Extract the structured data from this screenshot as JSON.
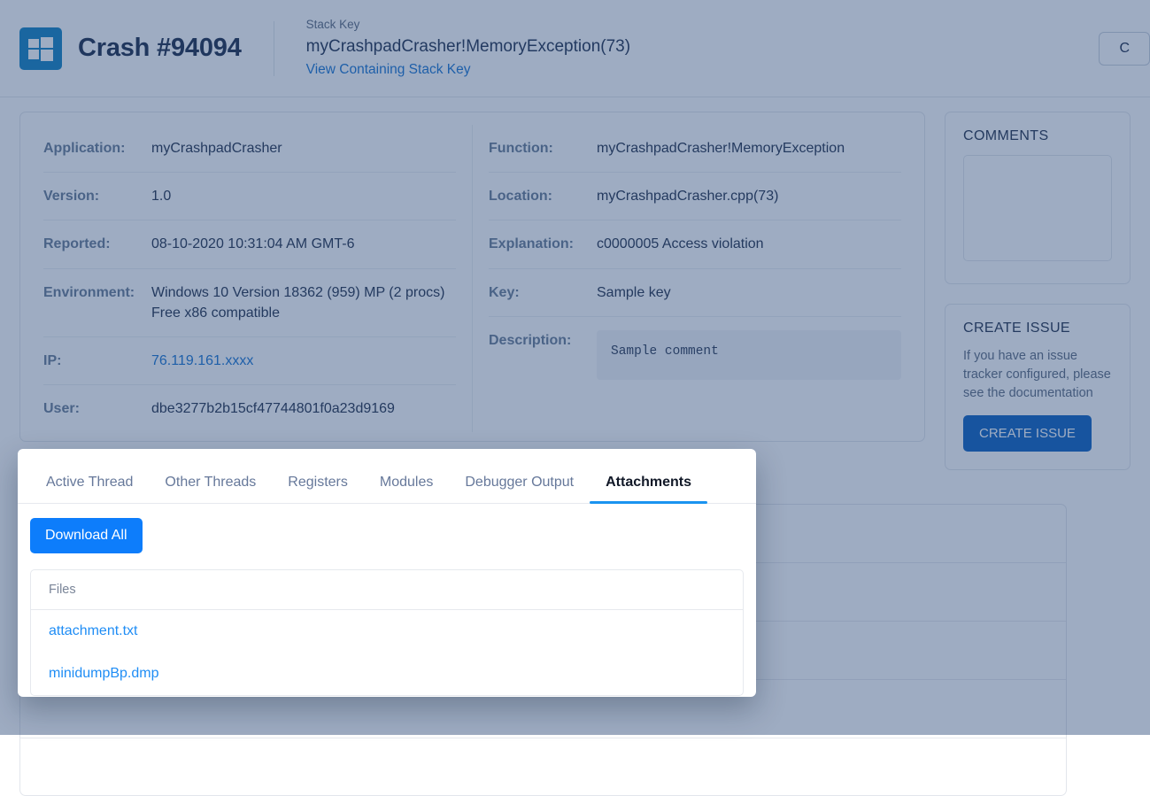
{
  "header": {
    "logo_icon": "windows-logo-icon",
    "crash_title": "Crash #94094",
    "stack_key_label": "Stack Key",
    "stack_key_value": "myCrashpadCrasher!MemoryException(73)",
    "stack_key_link": "View Containing Stack Key",
    "right_button": "C"
  },
  "details": {
    "left": [
      {
        "key": "Application:",
        "value": "myCrashpadCrasher",
        "link": false
      },
      {
        "key": "Version:",
        "value": "1.0",
        "link": false
      },
      {
        "key": "Reported:",
        "value": "08-10-2020 10:31:04 AM GMT-6",
        "link": false
      },
      {
        "key": "Environment:",
        "value": "Windows 10 Version 18362 (959) MP (2 procs) Free x86 compatible",
        "link": false
      },
      {
        "key": "IP:",
        "value": "76.119.161.xxxx",
        "link": true
      },
      {
        "key": "User:",
        "value": "dbe3277b2b15cf47744801f0a23d9169",
        "link": false
      }
    ],
    "right": [
      {
        "key": "Function:",
        "value": "myCrashpadCrasher!MemoryException",
        "link": false
      },
      {
        "key": "Location:",
        "value": "myCrashpadCrasher.cpp(73)",
        "link": false
      },
      {
        "key": "Explanation:",
        "value": "c0000005 Access violation",
        "link": false
      },
      {
        "key": "Key:",
        "value": "Sample key",
        "link": false
      }
    ],
    "description_label": "Description:",
    "description_value": "Sample comment"
  },
  "rail": {
    "comments_title": "COMMENTS",
    "comments_value": "",
    "comments_placeholder": "",
    "create_title": "CREATE ISSUE",
    "create_text": "If you have an issue tracker configured, please see the documentation",
    "create_button": "CREATE ISSUE"
  },
  "modal": {
    "tabs": [
      {
        "label": "Active Thread",
        "active": false
      },
      {
        "label": "Other Threads",
        "active": false
      },
      {
        "label": "Registers",
        "active": false
      },
      {
        "label": "Modules",
        "active": false
      },
      {
        "label": "Debugger Output",
        "active": false
      },
      {
        "label": "Attachments",
        "active": true
      }
    ],
    "download_all": "Download All",
    "files_header": "Files",
    "files": [
      {
        "name": "attachment.txt"
      },
      {
        "name": "minidumpBp.dmp"
      }
    ]
  },
  "colors": {
    "accent_blue": "#0d7dfb",
    "tab_underline": "#1a93f0",
    "link_blue": "#1f8df5",
    "rail_button": "#0a5fc0",
    "windows_logo": "#0f80c1",
    "overlay": "rgba(41,72,119,0.45)"
  }
}
